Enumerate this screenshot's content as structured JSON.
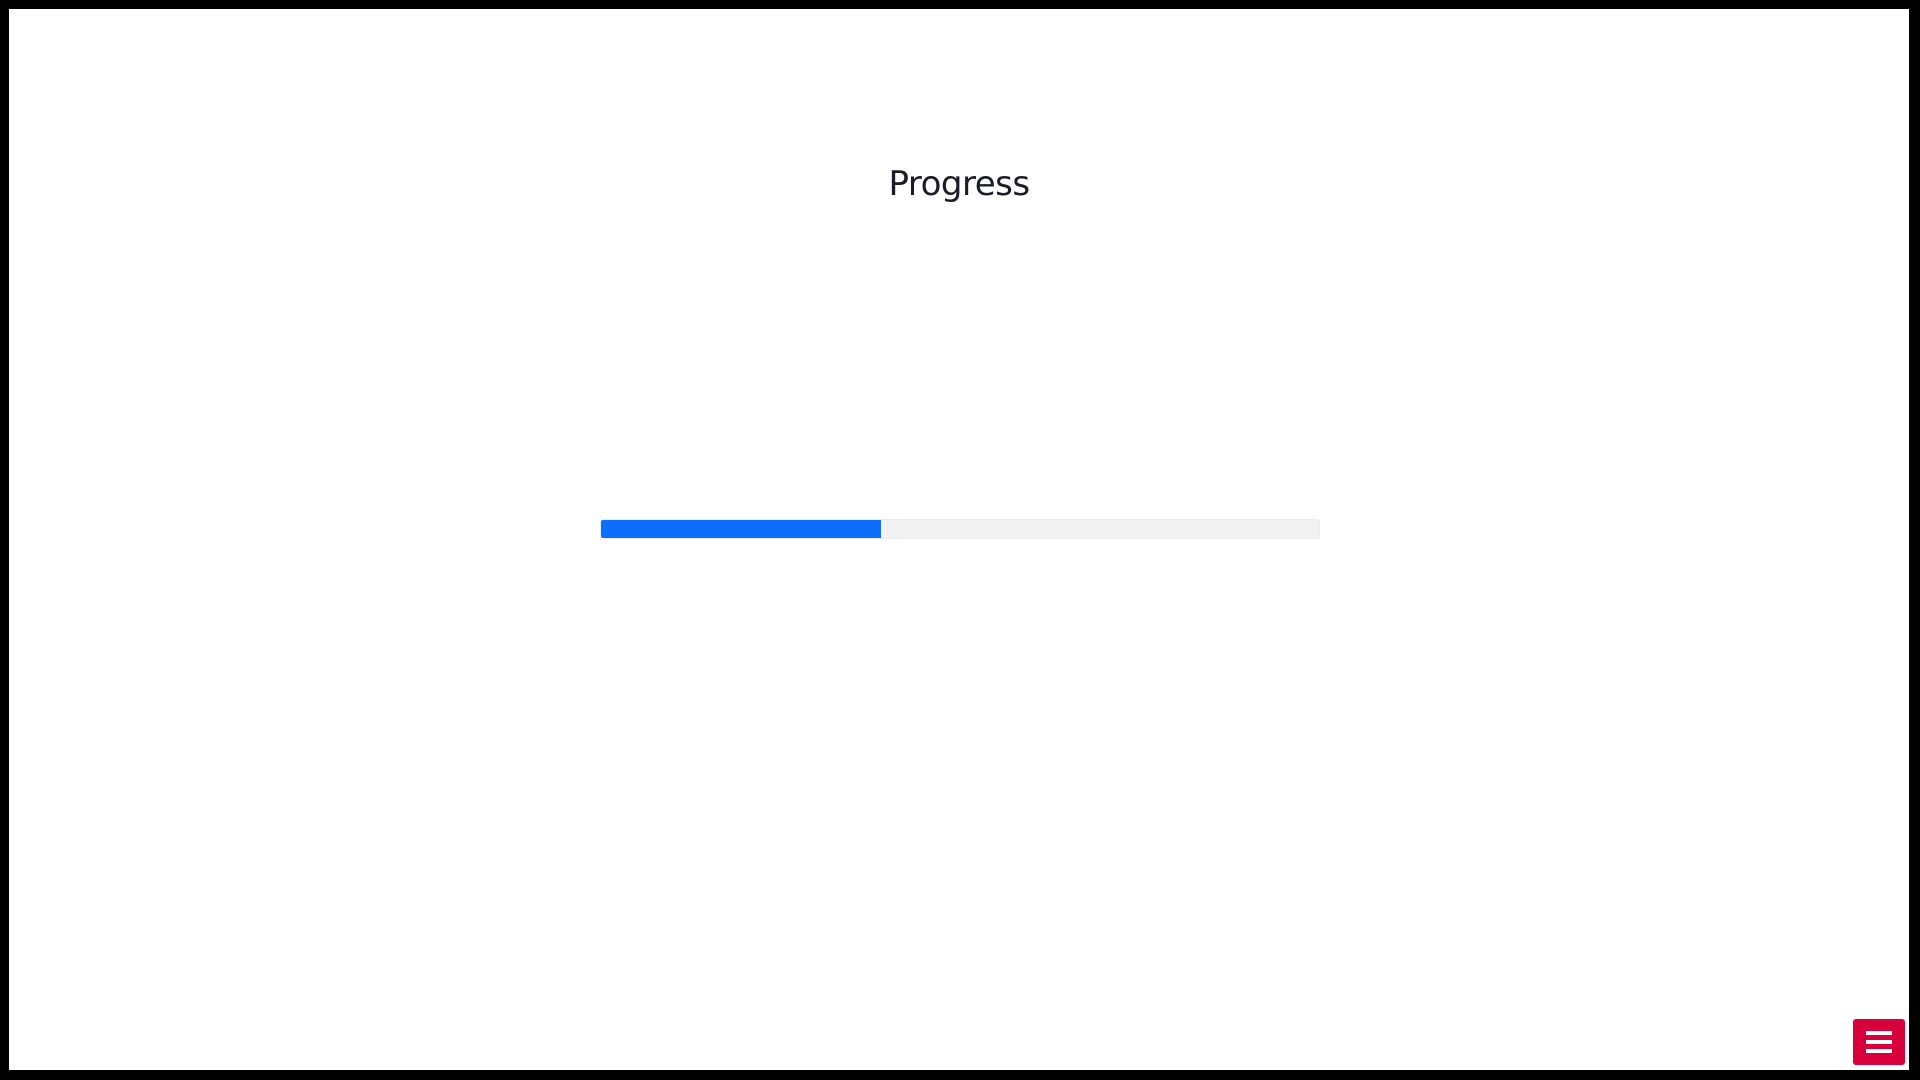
{
  "page": {
    "title": "Progress"
  },
  "progress": {
    "value_percent": 39,
    "fill_color": "#0d6efd",
    "track_color": "#f2f2f2"
  },
  "menu_button": {
    "icon": "hamburger-menu-icon",
    "color": "#d7003a"
  }
}
